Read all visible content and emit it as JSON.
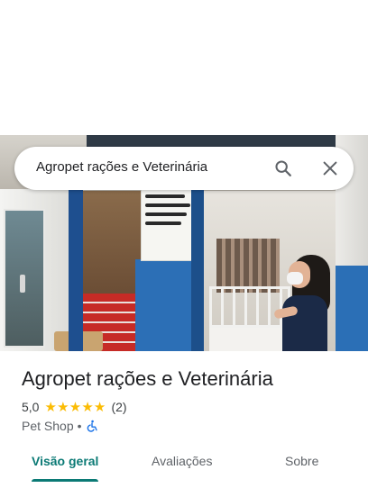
{
  "search": {
    "query": "Agropet rações e Veterinária",
    "search_icon": "search-icon",
    "close_icon": "close-icon"
  },
  "place": {
    "name": "Agropet rações e Veterinária",
    "rating": "5,0",
    "stars": 5,
    "review_count": "(2)",
    "category": "Pet Shop",
    "separator": "•",
    "accessibility_icon": "wheelchair-icon"
  },
  "tabs": [
    {
      "label": "Visão geral",
      "active": true
    },
    {
      "label": "Avaliações",
      "active": false
    },
    {
      "label": "Sobre",
      "active": false
    }
  ],
  "colors": {
    "accent": "#0b7a75",
    "star": "#fbbc04",
    "accessibility": "#1a73e8"
  }
}
